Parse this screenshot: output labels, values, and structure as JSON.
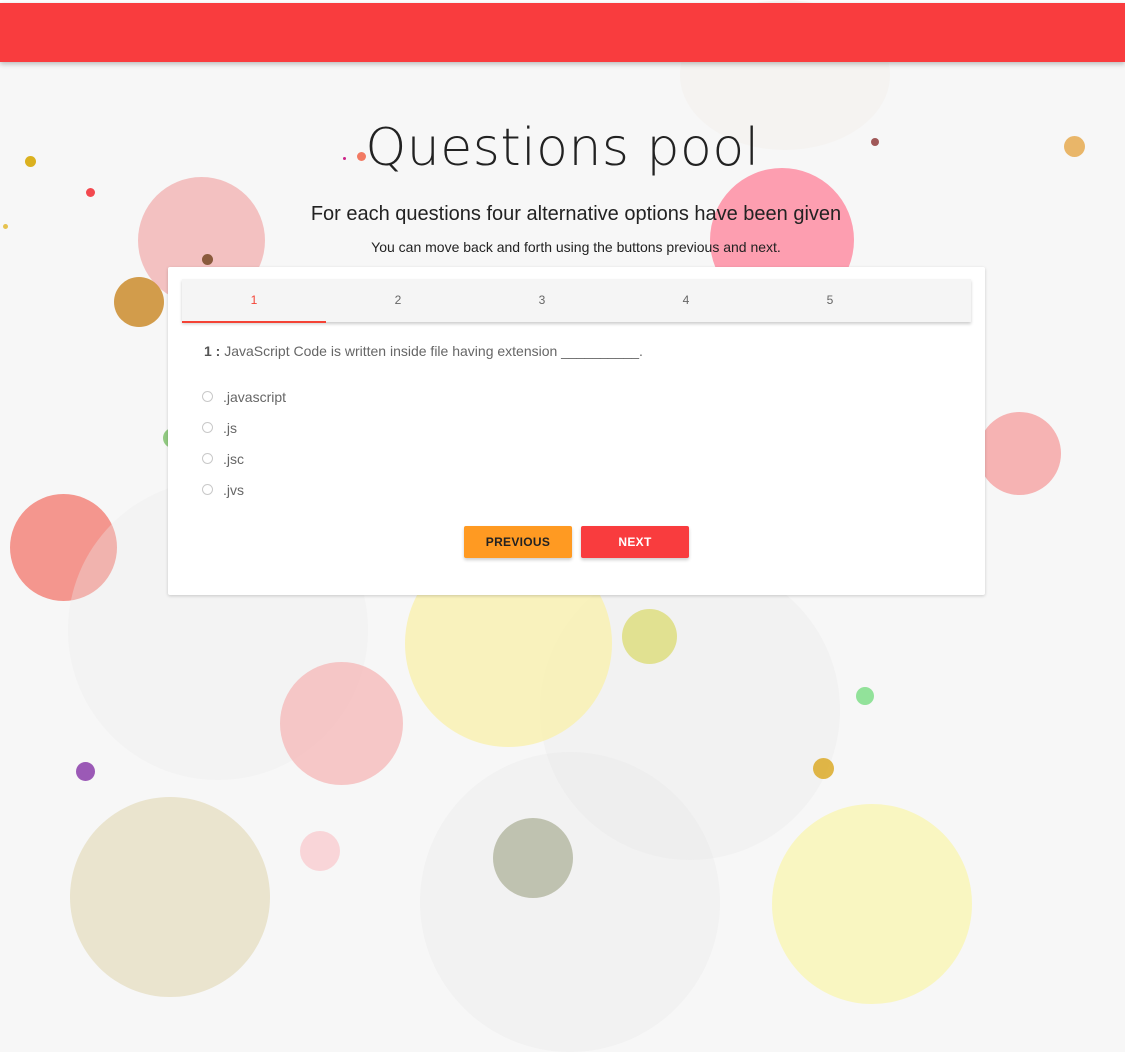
{
  "header": {
    "title": "Questions pool"
  },
  "intro": {
    "subtitle": "For each questions four alternative options have been given",
    "hint": "You can move back and forth using the buttons previous and next."
  },
  "tabs": [
    "1",
    "2",
    "3",
    "4",
    "5"
  ],
  "question": {
    "number": "1 :",
    "text": "JavaScript Code is written inside file having extension __________.",
    "options": [
      ".javascript",
      ".js",
      ".jsc",
      ".jvs"
    ]
  },
  "buttons": {
    "previous": "PREVIOUS",
    "next": "NEXT"
  },
  "colors": {
    "navbar": "#f93c3e",
    "accent": "#f44336",
    "previous": "#ff9a22"
  }
}
